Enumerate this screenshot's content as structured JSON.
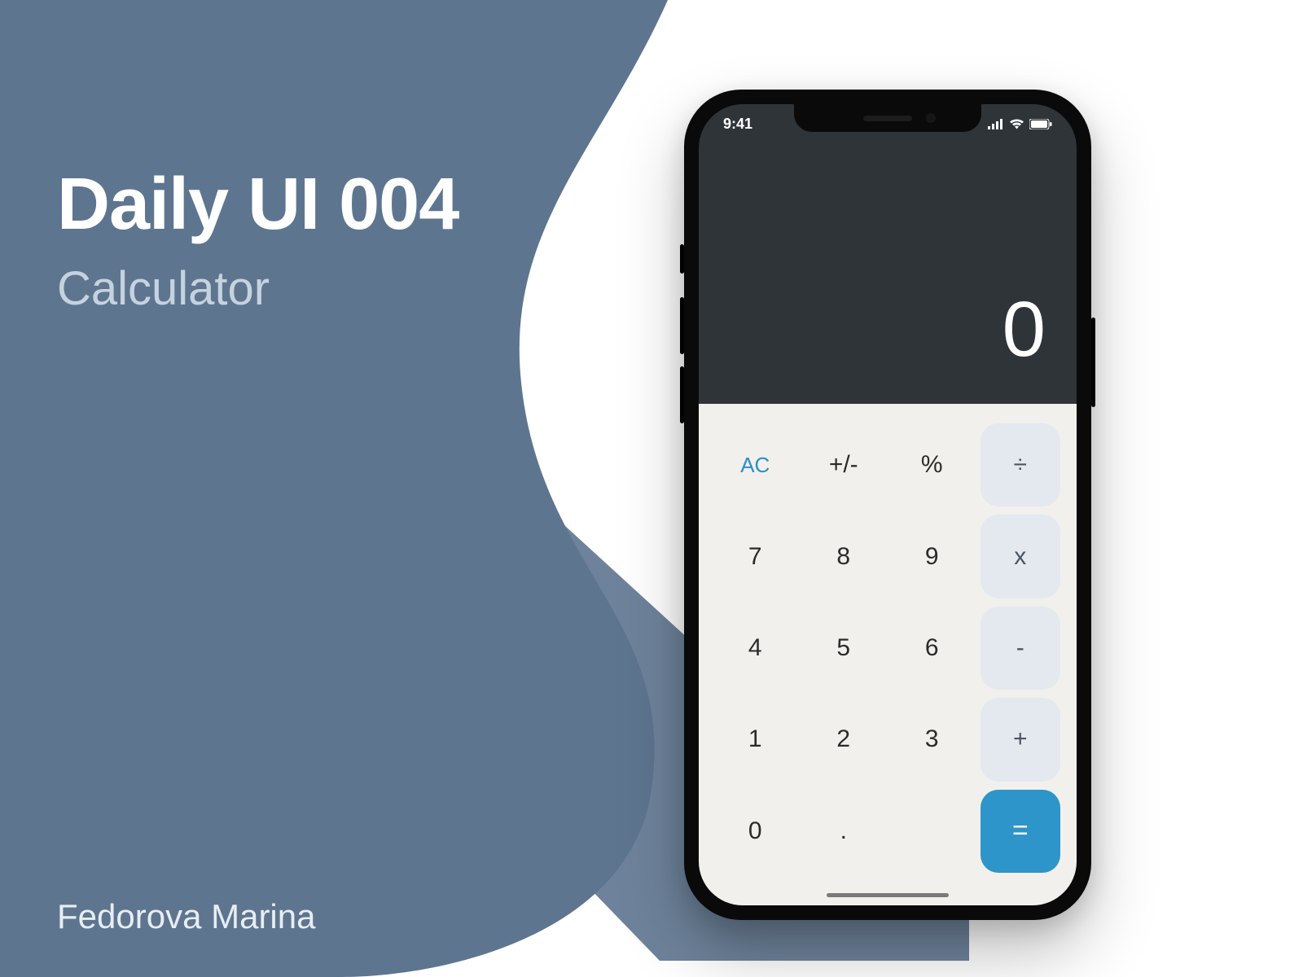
{
  "header": {
    "title": "Daily UI 004",
    "subtitle": "Calculator"
  },
  "author": "Fedorova Marina",
  "colors": {
    "background_blob": "#5e7590",
    "keypad_bg": "#f1f0ec",
    "display_bg": "#2f3438",
    "operator_key_bg": "#e3e9ee",
    "equals_key_bg": "#2d95c9",
    "accent_text": "#2a8fc9"
  },
  "phone": {
    "status": {
      "time": "9:41",
      "signal_icon": "signal-icon",
      "wifi_icon": "wifi-icon",
      "battery_icon": "battery-icon"
    },
    "calculator": {
      "display_value": "0",
      "keys": {
        "ac": "AC",
        "plus_minus": "+/-",
        "percent": "%",
        "divide": "÷",
        "seven": "7",
        "eight": "8",
        "nine": "9",
        "multiply": "x",
        "four": "4",
        "five": "5",
        "six": "6",
        "minus": "-",
        "one": "1",
        "two": "2",
        "three": "3",
        "plus": "+",
        "zero": "0",
        "decimal": ".",
        "equals": "="
      }
    }
  }
}
